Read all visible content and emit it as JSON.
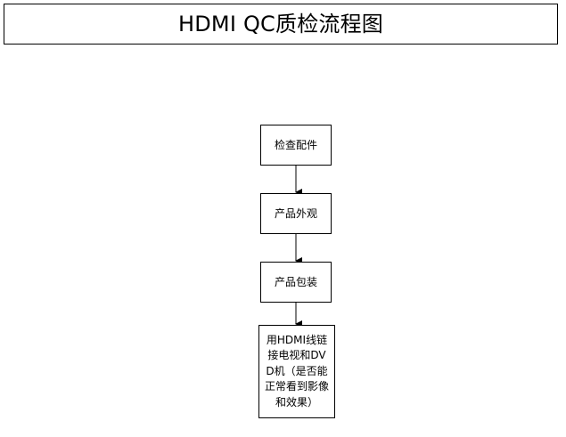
{
  "title": "HDMI QC质检流程图",
  "steps": [
    {
      "label": "检查配件"
    },
    {
      "label": "产品外观"
    },
    {
      "label": "产品包装"
    },
    {
      "label": "用HDMI线链接电视和DVD机（是否能正常看到影像和效果）"
    }
  ],
  "colors": {
    "stroke": "#000000",
    "background": "#ffffff"
  }
}
